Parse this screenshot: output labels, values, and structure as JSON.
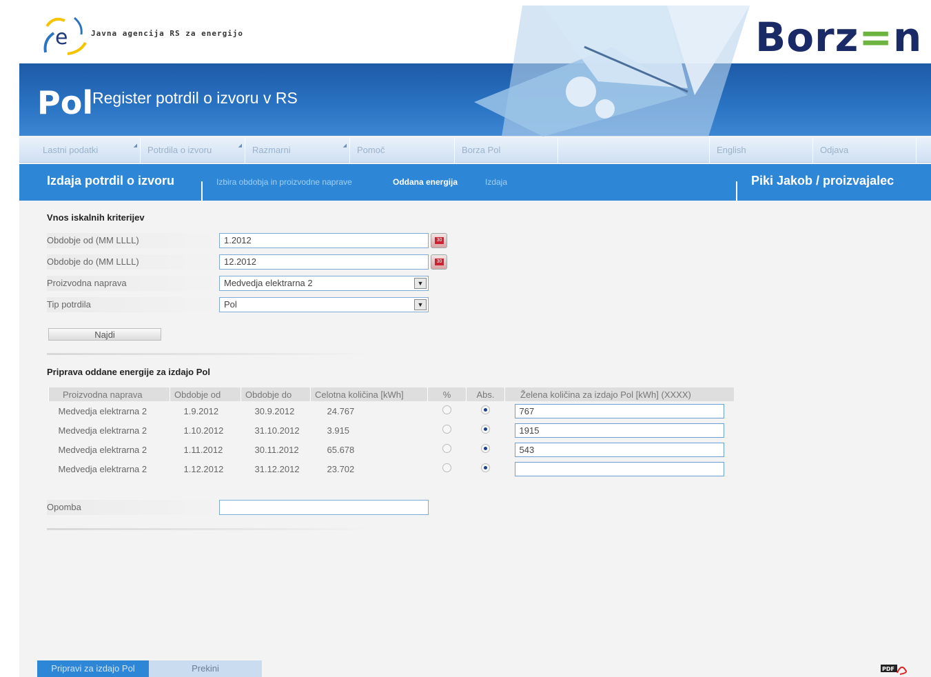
{
  "header": {
    "agency_logo_letter": "e",
    "agency_name": "Javna agencija RS za energijo",
    "brand_logo_prefix": "Borz",
    "brand_logo_accent": "=",
    "brand_logo_suffix": "n",
    "app_title": "Pol",
    "app_subtitle": "Register potrdil o izvoru v RS"
  },
  "nav": {
    "items": [
      {
        "label": "Lastni podatki"
      },
      {
        "label": "Potrdila o izvoru"
      },
      {
        "label": "Razmarni"
      },
      {
        "label": "Pomoč"
      },
      {
        "label": "Borza Pol"
      },
      {
        "label": ""
      },
      {
        "label": "English"
      },
      {
        "label": "Odjava"
      }
    ]
  },
  "section": {
    "title": "Izdaja potrdil o izvoru",
    "steps": [
      {
        "label": "Izbira obdobja in proizvodne naprave"
      },
      {
        "label": "Oddana energija"
      },
      {
        "label": "Izdaja"
      }
    ],
    "user": "Piki Jakob / proizvajalec"
  },
  "search": {
    "heading": "Vnos iskalnih kriterijev",
    "period_from_label": "Obdobje od (MM LLLL)",
    "period_from_value": "1.2012",
    "period_to_label": "Obdobje do (MM LLLL)",
    "period_to_value": "12.2012",
    "device_label": "Proizvodna naprava",
    "device_value": "Medvedja elektrarna 2",
    "type_label": "Tip potrdila",
    "type_value": "Pol",
    "calendar_text": "30",
    "find_button": "Najdi"
  },
  "energy": {
    "heading": "Priprava oddane energije za izdajo Pol",
    "columns": [
      "Proizvodna naprava",
      "Obdobje od",
      "Obdobje do",
      "Celotna količina [kWh]",
      "%",
      "Abs.",
      "Želena količina za izdajo Pol [kWh] (XXXX)"
    ],
    "rows": [
      {
        "device": "Medvedja elektrarna 2",
        "from": "1.9.2012",
        "to": "30.9.2012",
        "total": "24.767",
        "abs_selected": true,
        "desired": "767"
      },
      {
        "device": "Medvedja elektrarna 2",
        "from": "1.10.2012",
        "to": "31.10.2012",
        "total": "3.915",
        "abs_selected": true,
        "desired": "1915"
      },
      {
        "device": "Medvedja elektrarna 2",
        "from": "1.11.2012",
        "to": "30.11.2012",
        "total": "65.678",
        "abs_selected": true,
        "desired": "543"
      },
      {
        "device": "Medvedja elektrarna 2",
        "from": "1.12.2012",
        "to": "31.12.2012",
        "total": "23.702",
        "abs_selected": true,
        "desired": ""
      }
    ],
    "note_label": "Opomba",
    "note_value": ""
  },
  "footer": {
    "prepare_button": "Pripravi za izdajo Pol",
    "cancel_button": "Prekini",
    "pdf_icon_text": "PDF"
  },
  "colors": {
    "header_blue": "#2a74c4",
    "section_blue": "#2e86d6",
    "brand_navy": "#1a2a66",
    "brand_green": "#6db33f"
  }
}
